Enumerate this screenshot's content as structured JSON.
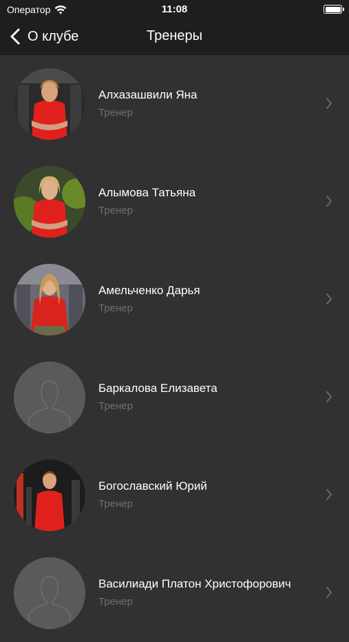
{
  "status_bar": {
    "carrier": "Оператор",
    "time": "11:08",
    "wifi_icon": "wifi-icon",
    "battery_icon": "battery-icon"
  },
  "nav_bar": {
    "back_label": "О клубе",
    "back_icon": "chevron-left-icon",
    "title": "Тренеры"
  },
  "trainers": [
    {
      "name": "Алхазашвили Яна",
      "role": "Тренер",
      "avatar": "photo"
    },
    {
      "name": "Алымова Татьяна",
      "role": "Тренер",
      "avatar": "photo"
    },
    {
      "name": "Амельченко Дарья",
      "role": "Тренер",
      "avatar": "photo"
    },
    {
      "name": "Баркалова Елизавета",
      "role": "Тренер",
      "avatar": "placeholder"
    },
    {
      "name": "Богославский Юрий",
      "role": "Тренер",
      "avatar": "photo"
    },
    {
      "name": "Василиади Платон Христофорович",
      "role": "Тренер",
      "avatar": "placeholder"
    }
  ],
  "colors": {
    "background": "#313131",
    "bar": "#1e1e1e",
    "shirt_red": "#e0201c",
    "secondary_text": "#6f6f6f",
    "chevron": "#6a6a6a"
  }
}
